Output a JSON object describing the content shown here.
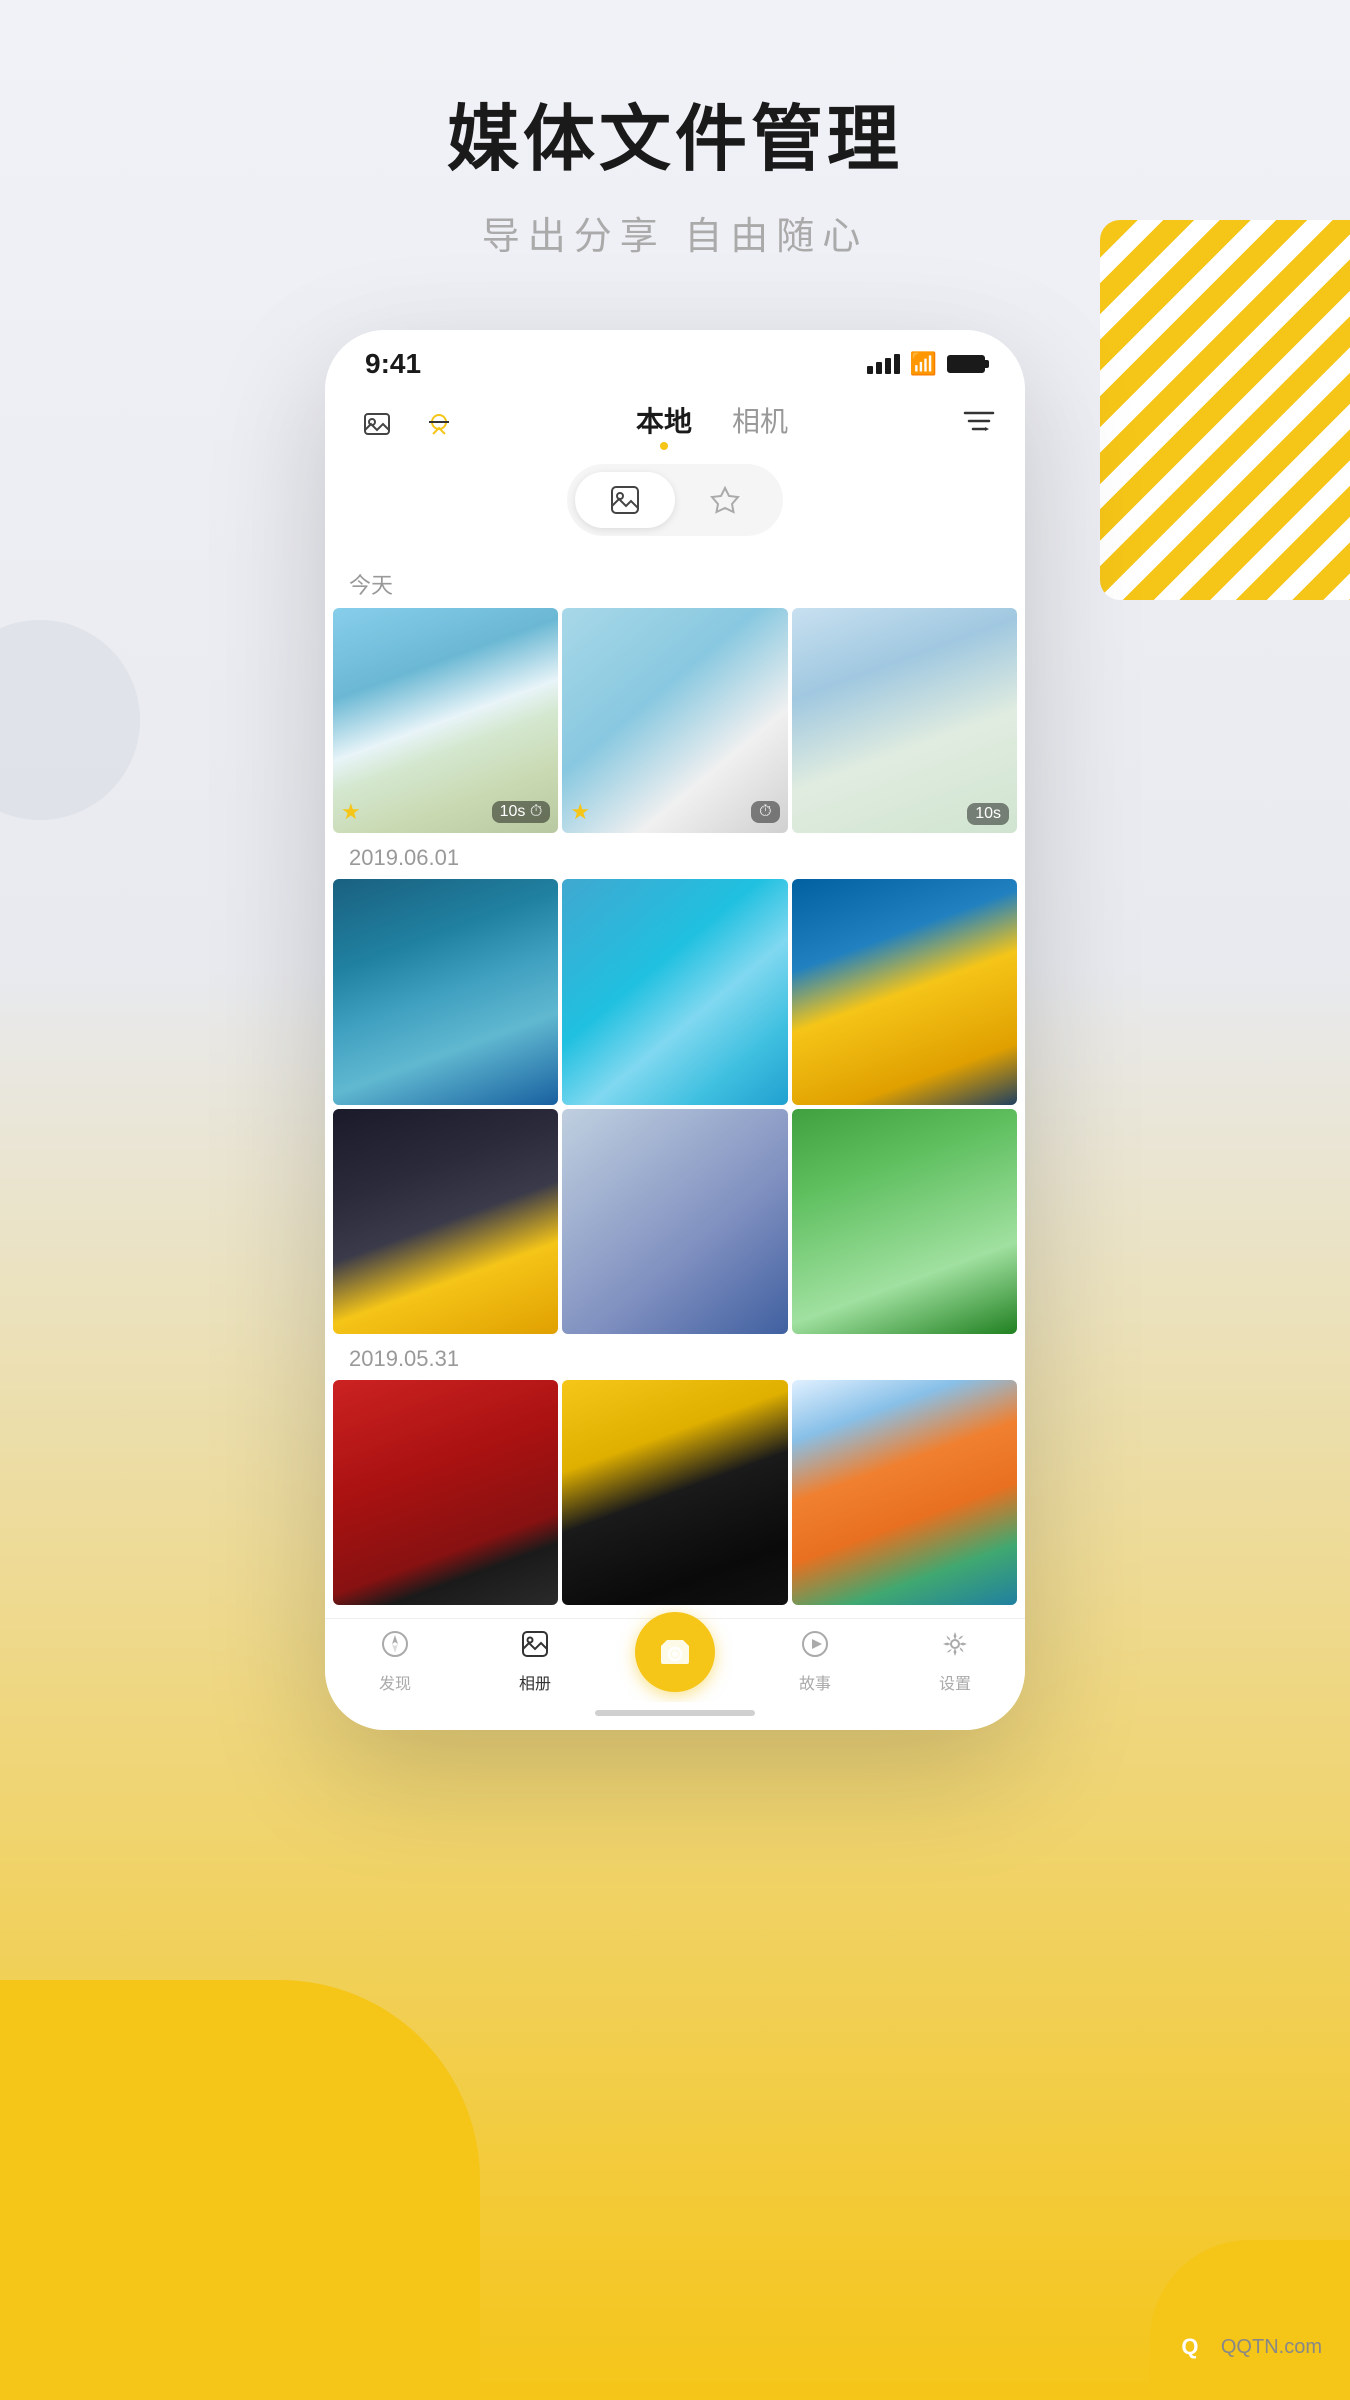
{
  "page": {
    "title": "媒体文件管理",
    "subtitle": "导出分享 自由随心",
    "background_color": "#f0f2f7"
  },
  "status_bar": {
    "time": "9:41"
  },
  "app_nav": {
    "tabs": [
      {
        "label": "本地",
        "active": true
      },
      {
        "label": "相机",
        "active": false
      }
    ],
    "filter_label": "filter"
  },
  "toggle": {
    "options": [
      {
        "label": "photos",
        "active": true
      },
      {
        "label": "favorite",
        "active": false
      }
    ]
  },
  "sections": [
    {
      "date": "今天",
      "photos": [
        {
          "style": "photo-ski-jump",
          "starred": true,
          "duration": "10s",
          "has_timer": true
        },
        {
          "style": "photo-ski-black",
          "starred": true,
          "duration": "",
          "has_timer": true
        },
        {
          "style": "photo-ski-lift",
          "starred": false,
          "duration": "10s",
          "has_timer": false
        }
      ]
    },
    {
      "date": "2019.06.01",
      "photos": [
        {
          "style": "photo-surf-red",
          "starred": false,
          "duration": "",
          "has_timer": false
        },
        {
          "style": "photo-surf-wave",
          "starred": false,
          "duration": "",
          "has_timer": false
        },
        {
          "style": "photo-surf-board",
          "starred": false,
          "duration": "",
          "has_timer": false
        },
        {
          "style": "photo-skate-city",
          "starred": false,
          "duration": "",
          "has_timer": false
        },
        {
          "style": "photo-skate-jump",
          "starred": false,
          "duration": "",
          "has_timer": false
        },
        {
          "style": "photo-dog-grass",
          "starred": false,
          "duration": "",
          "has_timer": false
        }
      ]
    },
    {
      "date": "2019.05.31",
      "photos": [
        {
          "style": "photo-pug-red",
          "starred": false,
          "duration": "",
          "has_timer": false
        },
        {
          "style": "photo-pug-yellow",
          "starred": false,
          "duration": "",
          "has_timer": false
        },
        {
          "style": "photo-colorful",
          "starred": false,
          "duration": "",
          "has_timer": false
        }
      ]
    }
  ],
  "bottom_nav": {
    "items": [
      {
        "label": "发现",
        "icon": "compass",
        "active": false
      },
      {
        "label": "相册",
        "icon": "photos",
        "active": true
      },
      {
        "label": "",
        "icon": "camera",
        "active": false,
        "is_camera": true
      },
      {
        "label": "故事",
        "icon": "play",
        "active": false
      },
      {
        "label": "设置",
        "icon": "gear",
        "active": false
      }
    ]
  },
  "watermark": {
    "site": "QQTN.com"
  }
}
